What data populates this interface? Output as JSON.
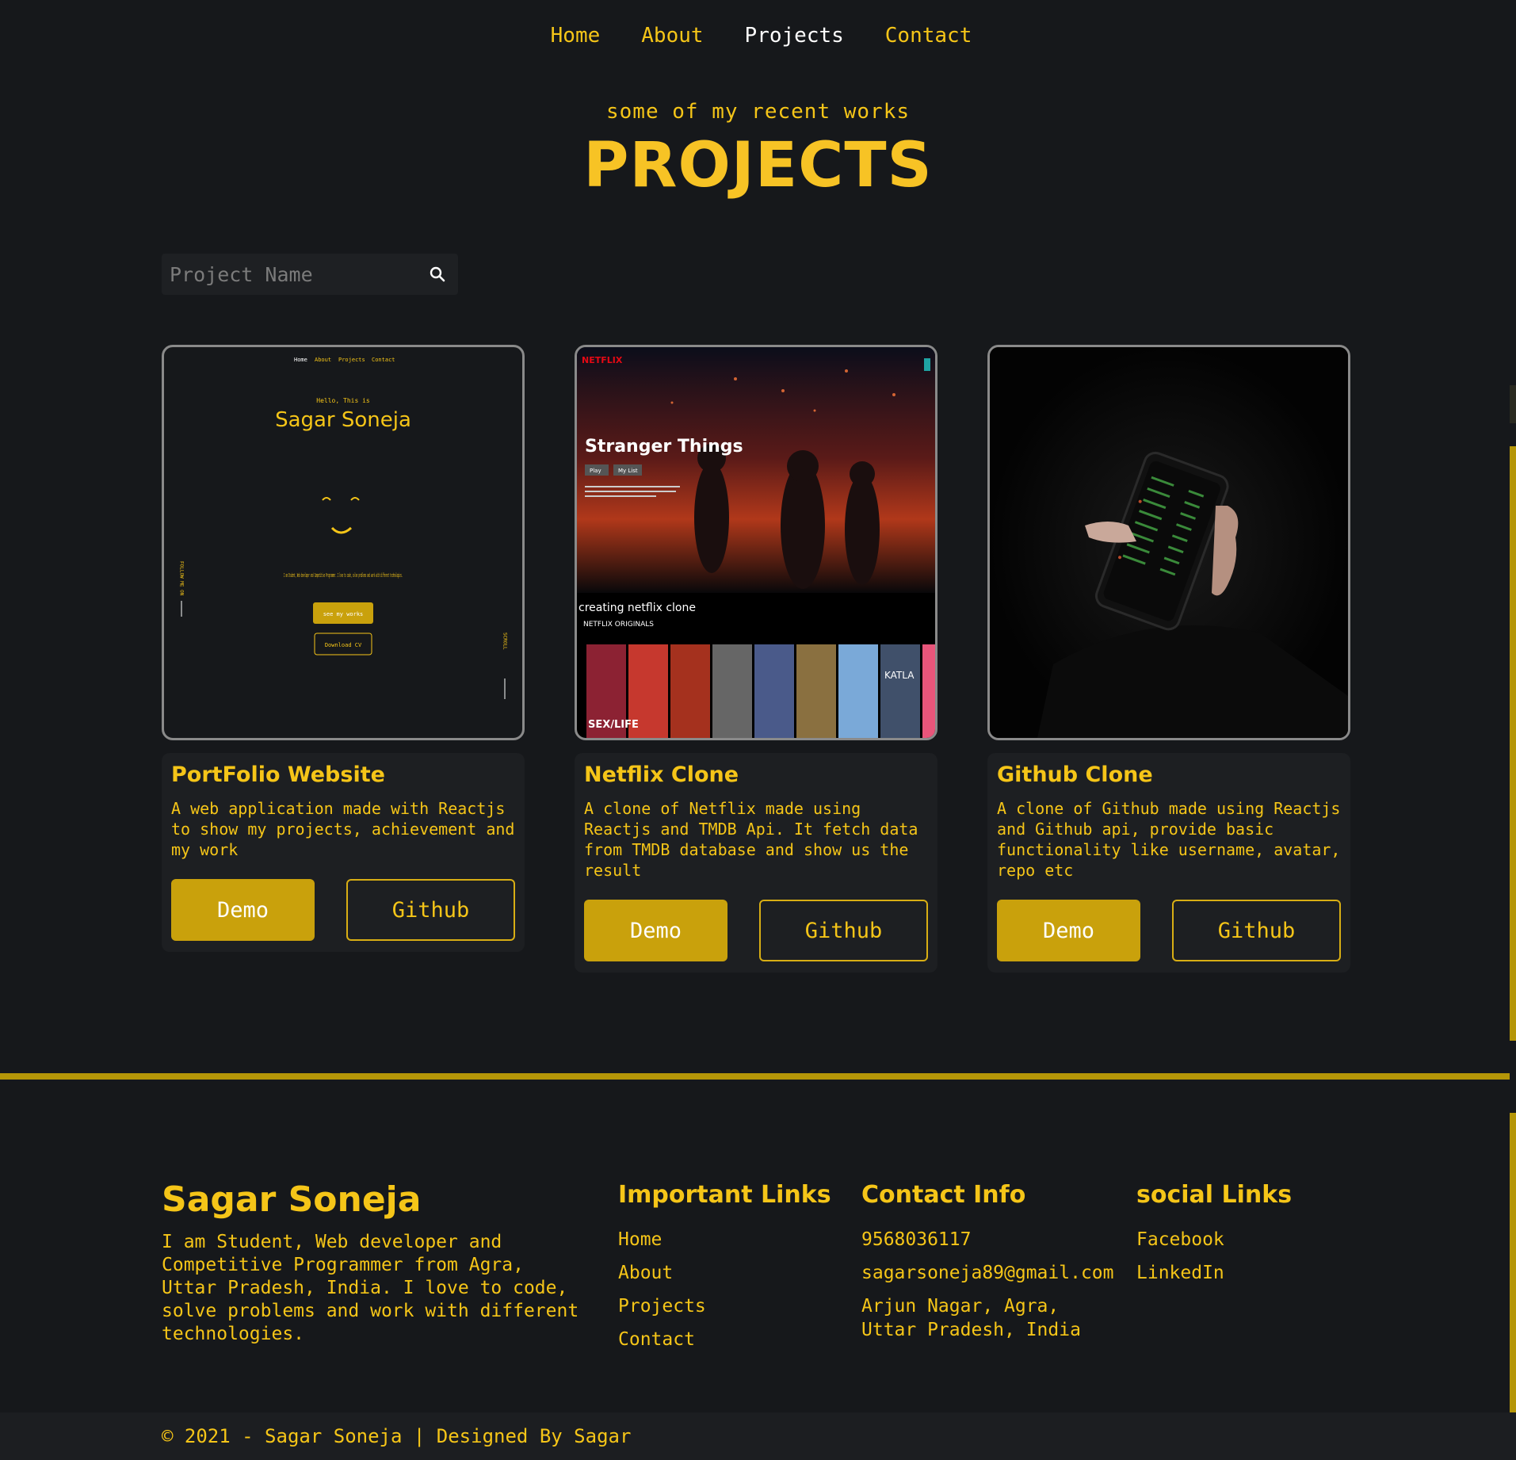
{
  "nav": {
    "items": [
      {
        "label": "Home"
      },
      {
        "label": "About"
      },
      {
        "label": "Projects"
      },
      {
        "label": "Contact"
      }
    ],
    "active": "Projects"
  },
  "header": {
    "subtitle": "some of my recent works",
    "title": "PROJECTS"
  },
  "search": {
    "placeholder": "Project Name",
    "icon": "search-icon"
  },
  "projects": [
    {
      "title": "PortFolio Website",
      "description": "A web application made with Reactjs to show my projects, achievement and my work",
      "demo_label": "Demo",
      "github_label": "Github",
      "preview": {
        "nav": [
          "Home",
          "About",
          "Projects",
          "Contact"
        ],
        "greeting": "Hello, This is",
        "name": "Sagar Soneja",
        "about": "I am Student, Web developer and Competitive Programmer. I love to code, solve problems and work with different technologies.",
        "btn1": "see my works",
        "btn2": "Download CV",
        "side_left": "FOLLOW ME ON",
        "side_right": "SCROLL"
      }
    },
    {
      "title": "Netflix Clone",
      "description": "A clone of Netflix made using Reactjs and TMDB Api. It fetch data from TMDB database and show us the result",
      "demo_label": "Demo",
      "github_label": "Github",
      "preview": {
        "logo": "NETFLIX",
        "hero_title": "Stranger Things",
        "hero_btn1": "Play",
        "hero_btn2": "My List",
        "row_title": "creating netflix clone",
        "row_label": "NETFLIX ORIGINALS",
        "poster1": "SEX/LIFE",
        "poster2": "KATLA"
      }
    },
    {
      "title": "Github Clone",
      "description": "A clone of Github made using Reactjs and Github api, provide basic functionality like username, avatar, repo etc",
      "demo_label": "Demo",
      "github_label": "Github",
      "preview": {
        "subject": "phone-in-hand"
      }
    }
  ],
  "footer": {
    "name": "Sagar Soneja",
    "about": "I am Student, Web developer and Competitive Programmer from Agra, Uttar Pradesh, India. I love to code, solve problems and work with different technologies.",
    "important_links": {
      "heading": "Important Links",
      "items": [
        "Home",
        "About",
        "Projects",
        "Contact"
      ]
    },
    "contact_info": {
      "heading": "Contact Info",
      "phone": "9568036117",
      "email": "sagarsoneja89@gmail.com",
      "address": "Arjun Nagar, Agra, Uttar Pradesh, India"
    },
    "social_links": {
      "heading": "social Links",
      "items": [
        "Facebook",
        "LinkedIn"
      ]
    },
    "copyright": "© 2021 - Sagar Soneja | Designed By Sagar"
  },
  "colors": {
    "background": "#16181b",
    "accent": "#f5c518",
    "button": "#c9a10c",
    "divider": "#b59608"
  }
}
